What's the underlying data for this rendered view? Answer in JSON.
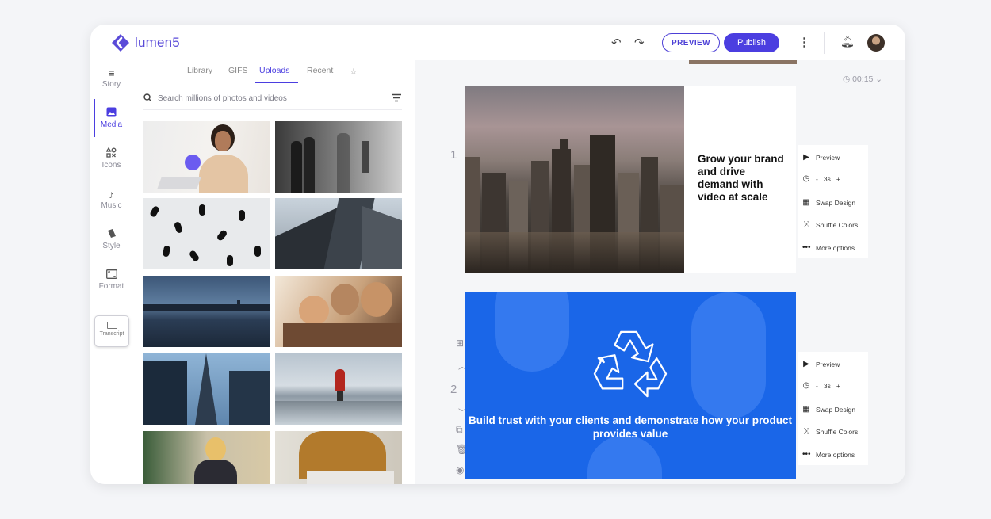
{
  "app": {
    "logo_text": "lumen5",
    "brand_color": "#4b3ee0",
    "preview_label": "PREVIEW",
    "publish_label": "Publish"
  },
  "rail": {
    "items": [
      {
        "label": "Story",
        "icon": "story-icon"
      },
      {
        "label": "Media",
        "icon": "media-icon"
      },
      {
        "label": "Icons",
        "icon": "icons-icon"
      },
      {
        "label": "Music",
        "icon": "music-icon"
      },
      {
        "label": "Style",
        "icon": "style-icon"
      },
      {
        "label": "Format",
        "icon": "format-icon"
      }
    ],
    "transcript_label": "Transcript"
  },
  "media_panel": {
    "tabs": [
      "Library",
      "GIFS",
      "Uploads",
      "Recent"
    ],
    "active_tab": "Uploads",
    "search_placeholder": "Search millions of photos and videos",
    "thumbnails": [
      "woman-laptop",
      "office-people",
      "crowd-aerial",
      "skyscrapers",
      "city-skyline-dusk",
      "friends-laughing",
      "glass-towers",
      "hiker-snow",
      "woman-phone-call",
      "man-yellow-sweater"
    ]
  },
  "canvas": {
    "duration": "00:15",
    "scenes": [
      {
        "number": "1",
        "text": "Grow your brand and drive demand with video at scale",
        "options": {
          "preview": "Preview",
          "duration_value": "3s",
          "minus": "-",
          "plus": "+",
          "swap_design": "Swap Design",
          "shuffle_colors": "Shuffle Colors",
          "more_options": "More options"
        }
      },
      {
        "number": "2",
        "text": "Build trust with your clients and demonstrate how your product provides value",
        "background_color": "#1a66e8",
        "options": {
          "preview": "Preview",
          "duration_value": "3s",
          "minus": "-",
          "plus": "+",
          "swap_design": "Swap Design",
          "shuffle_colors": "Shuffle Colors",
          "more_options": "More options"
        }
      }
    ]
  }
}
